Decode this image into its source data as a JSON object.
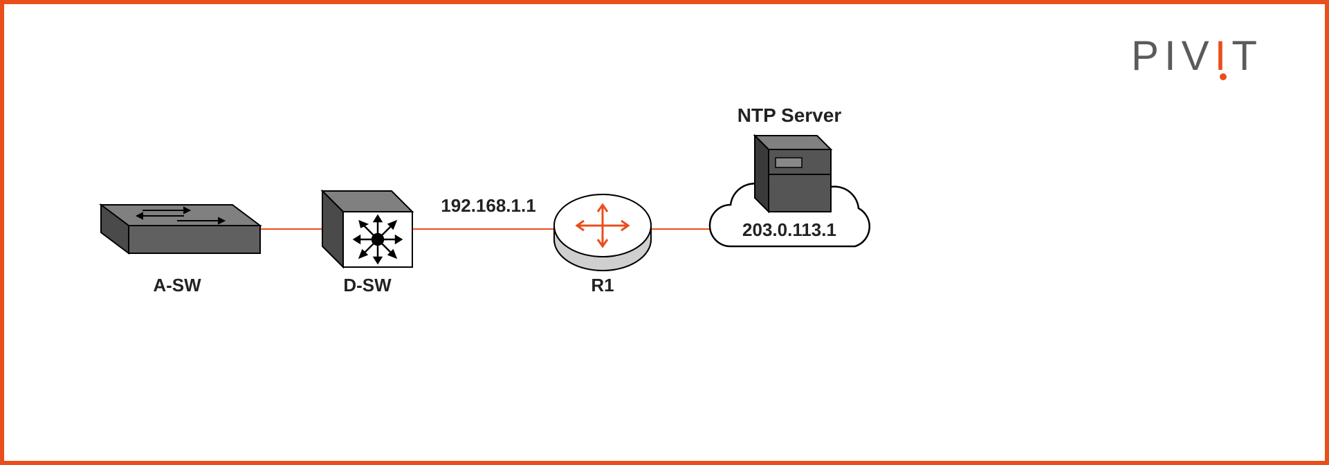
{
  "brand": {
    "p1": "PIV",
    "accent": "I",
    "p2": "T"
  },
  "nodes": {
    "asw": {
      "label": "A-SW"
    },
    "dsw": {
      "label": "D-SW"
    },
    "r1": {
      "label": "R1",
      "ip": "192.168.1.1"
    },
    "server": {
      "title": "NTP Server",
      "ip": "203.0.113.1"
    }
  }
}
